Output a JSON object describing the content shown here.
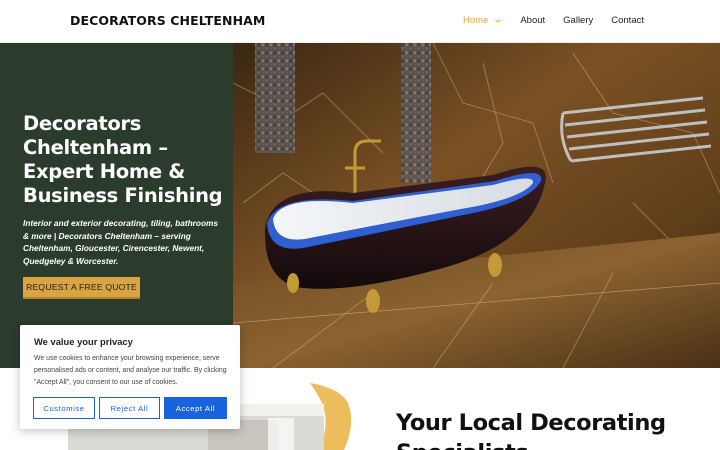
{
  "header": {
    "logo": "DECORATORS CHELTENHAM",
    "nav": [
      {
        "label": "Home",
        "active": true
      },
      {
        "label": "About"
      },
      {
        "label": "Gallery"
      },
      {
        "label": "Contact"
      }
    ]
  },
  "hero": {
    "title": "Decorators Cheltenham – Expert Home & Business Finishing",
    "subtitle": "Interior and exterior decorating, tiling, bathrooms & more | Decorators Cheltenham – serving Cheltenham, Gloucester, Cirencester, Newent, Quedgeley & Worcester.",
    "cta": "REQUEST A FREE QUOTE"
  },
  "section": {
    "heading": "Your Local Decorating Specialists"
  },
  "cookie": {
    "title": "We value your privacy",
    "text": "We use cookies to enhance your browsing experience, serve personalised ads or content, and analyse our traffic. By clicking \"Accept All\", you consent to our use of cookies.",
    "customise": "Customise",
    "reject": "Reject All",
    "accept": "Accept All"
  },
  "colors": {
    "accent": "#e3a832",
    "hero_panel": "#2b3b2c",
    "cta_bg": "#d9a441",
    "cookie_blue": "#1863dc"
  }
}
